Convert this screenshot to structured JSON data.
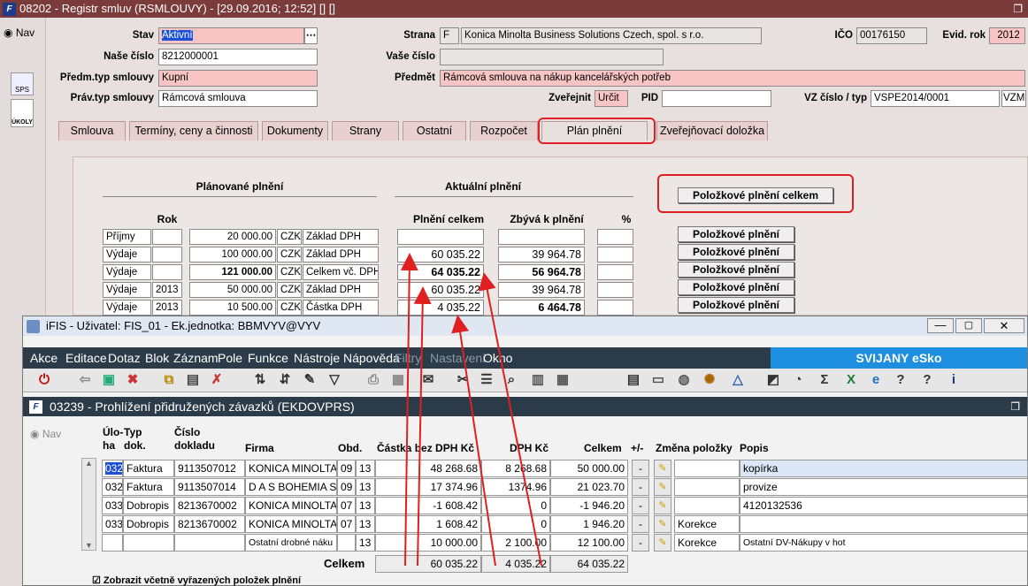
{
  "main": {
    "title": "08202 - Registr smluv (RSMLOUVY) - [29.09.2016; 12:52] [] []",
    "nav": "Nav",
    "side_icons": [
      "SPS",
      "ÚKOLY"
    ],
    "fields": {
      "stav_label": "Stav",
      "stav_value": "Aktivní",
      "nase_label": "Naše číslo",
      "nase_value": "8212000001",
      "predm_typ_label": "Předm.typ smlouvy",
      "predm_typ_value": "Kupní",
      "prav_typ_label": "Práv.typ smlouvy",
      "prav_typ_value": "Rámcová smlouva",
      "strana_label": "Strana",
      "strana_code": "F",
      "strana_value": "Konica Minolta Business Solutions Czech, spol. s r.o.",
      "vase_label": "Vaše číslo",
      "vase_value": "",
      "predmet_label": "Předmět",
      "predmet_value": "Rámcová smlouva na nákup kancelářských potřeb",
      "zverejnit_label": "Zveřejnit",
      "zverejnit_value": "Určit",
      "pid_label": "PID",
      "pid_value": "",
      "ico_label": "IČO",
      "ico_value": "00176150",
      "evid_label": "Evid. rok",
      "evid_value": "2012",
      "vz_label": "VZ číslo / typ",
      "vz_value": "VSPE2014/0001",
      "vz_type": "VZM"
    },
    "tabs": [
      "Smlouva",
      "Termíny, ceny a činnosti",
      "Dokumenty",
      "Strany",
      "Ostatní",
      "Rozpočet",
      "Plán plnění",
      "Zveřejňovací doložka"
    ],
    "plan": {
      "planned_header": "Plánované plnění",
      "actual_header": "Aktuální plnění",
      "rok_header": "Rok",
      "plneni_celkem_header": "Plnění celkem",
      "zbyva_header": "Zbývá k plnění",
      "pct_header": "%",
      "total_button": "Položkové plnění celkem",
      "rows": [
        {
          "type": "Příjmy",
          "rok": "",
          "amount": "20 000.00",
          "cur": "CZK",
          "basis": "Základ DPH",
          "plneni": "",
          "zbyva": "",
          "button": "Položkové plnění"
        },
        {
          "type": "Výdaje",
          "rok": "",
          "amount": "100 000.00",
          "cur": "CZK",
          "basis": "Základ DPH",
          "plneni": "60 035.22",
          "zbyva": "39 964.78",
          "button": "Položkové plnění"
        },
        {
          "type": "Výdaje",
          "rok": "",
          "amount": "121 000.00",
          "cur": "CZK",
          "basis": "Celkem vč. DPH",
          "plneni": "64 035.22",
          "zbyva": "56 964.78",
          "button": "Položkové plnění"
        },
        {
          "type": "Výdaje",
          "rok": "2013",
          "amount": "50 000.00",
          "cur": "CZK",
          "basis": "Základ DPH",
          "plneni": "60 035.22",
          "zbyva": "39 964.78",
          "button": "Položkové plnění"
        },
        {
          "type": "Výdaje",
          "rok": "2013",
          "amount": "10 500.00",
          "cur": "CZK",
          "basis": "Částka DPH",
          "plneni": "4 035.22",
          "zbyva": "6 464.78",
          "button": "Položkové plnění"
        }
      ]
    }
  },
  "popup": {
    "title": "iFIS - Uživatel: FIS_01 - Ek.jednotka: BBMVYV@VYV",
    "menu": [
      "Akce",
      "Editace",
      "Dotaz",
      "Blok",
      "Záznam",
      "Pole",
      "Funkce",
      "Nástroje",
      "Nápověda",
      "Filtry",
      "Nastavení",
      "Okno"
    ],
    "brand": "SVIJANY eSko",
    "subtitle": "03239 - Prohlížení přidružených závazků (EKDOVPRS)",
    "nav": "Nav",
    "headers": {
      "uloha": "Úlo-\nha",
      "typ": "Typ\ndok.",
      "cislo": "Číslo\ndokladu",
      "firma": "Firma",
      "obd": "Obd.",
      "castka": "Částka bez DPH Kč",
      "dph": "DPH Kč",
      "celkem": "Celkem",
      "pm": "+/-",
      "zmena": "Změna položky",
      "popis": "Popis"
    },
    "rows": [
      {
        "uloha": "032",
        "typ": "Faktura",
        "cislo": "9113507012",
        "firma": "KONICA MINOLTA",
        "obd1": "09",
        "obd2": "13",
        "castka": "48 268.68",
        "dph": "8 268.68",
        "celkem": "50 000.00",
        "pm": "-",
        "zmena": "",
        "popis": "kopírka"
      },
      {
        "uloha": "032",
        "typ": "Faktura",
        "cislo": "9113507014",
        "firma": "D A S BOHEMIA S",
        "obd1": "09",
        "obd2": "13",
        "castka": "17 374.96",
        "dph": "1374.96",
        "celkem": "21 023.70",
        "pm": "-",
        "zmena": "",
        "popis": "provize"
      },
      {
        "uloha": "033",
        "typ": "Dobropis",
        "cislo": "8213670002",
        "firma": "KONICA MINOLTA",
        "obd1": "07",
        "obd2": "13",
        "castka": "-1 608.42",
        "dph": "0",
        "celkem": "-1 946.20",
        "pm": "-",
        "zmena": "",
        "popis": "4120132536"
      },
      {
        "uloha": "033",
        "typ": "Dobropis",
        "cislo": "8213670002",
        "firma": "KONICA MINOLTA",
        "obd1": "07",
        "obd2": "13",
        "castka": "1 608.42",
        "dph": "0",
        "celkem": "1 946.20",
        "pm": "-",
        "zmena": "Korekce",
        "popis": ""
      },
      {
        "uloha": "",
        "typ": "",
        "cislo": "",
        "firma": "Ostatní drobné náku",
        "obd1": "",
        "obd2": "13",
        "castka": "10 000.00",
        "dph": "2 100.00",
        "celkem": "12 100.00",
        "pm": "-",
        "zmena": "Korekce",
        "popis": "Ostatní DV-Nákupy v hot"
      }
    ],
    "total_label": "Celkem",
    "total_castka": "60 035.22",
    "total_dph": "4 035.22",
    "total_celkem": "64 035.22",
    "checkbox_label": "Zobrazit včetně vyřazených položek plnění"
  }
}
